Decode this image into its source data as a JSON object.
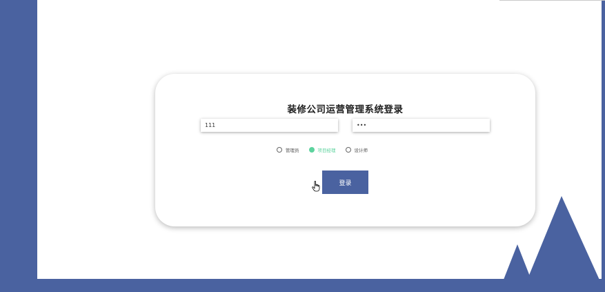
{
  "login": {
    "title": "装修公司运营管理系统登录",
    "username_value": "111",
    "password_value": "111",
    "roles": [
      {
        "label": "管理员",
        "selected": false
      },
      {
        "label": "项目经理",
        "selected": true
      },
      {
        "label": "设计师",
        "selected": false
      }
    ],
    "submit_label": "登录"
  },
  "colors": {
    "brand": "#4a62a0",
    "selected_role": "#5dd39e",
    "card_bg": "#ffffff"
  },
  "icons": {
    "cursor": "hand-pointer-icon",
    "decoration": "mountain-icon"
  }
}
